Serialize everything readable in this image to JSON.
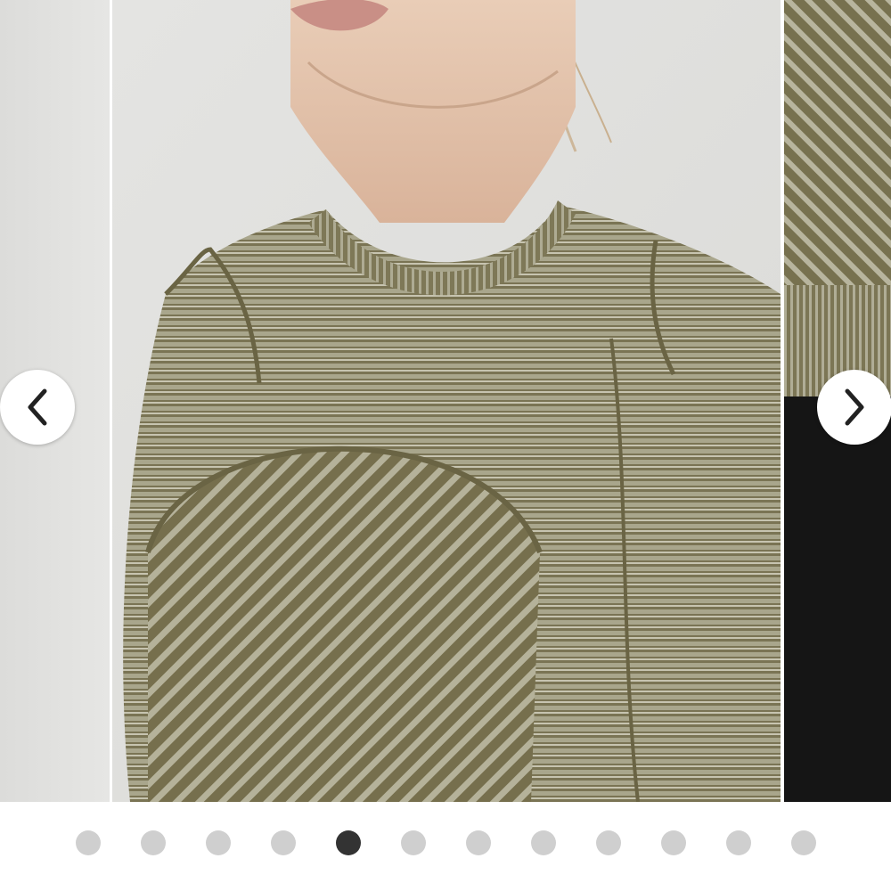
{
  "carousel": {
    "prev_button": {
      "icon": "chevron-left-icon"
    },
    "next_button": {
      "icon": "chevron-right-icon"
    },
    "slides": [
      {
        "id": "previous",
        "description": ""
      },
      {
        "id": "current",
        "description": ""
      },
      {
        "id": "next",
        "description": ""
      }
    ],
    "pagination": {
      "total": 12,
      "active_index": 4
    }
  },
  "colors": {
    "background": "#ffffff",
    "dot_inactive": "#cfcfcf",
    "dot_active": "#333333",
    "fabric_olive": "#6e6a4a",
    "fabric_light": "#c9c6b3",
    "backdrop_gray": "#e3e3e1",
    "black_panel": "#151515"
  }
}
